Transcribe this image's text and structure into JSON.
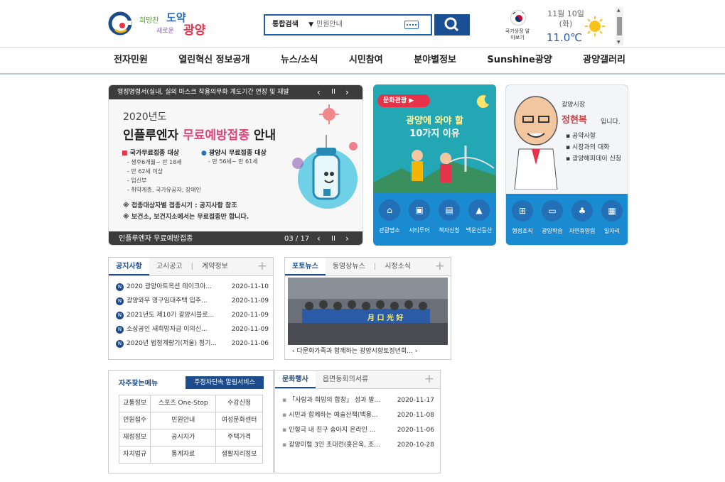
{
  "header": {
    "logo_slogan_1": "희망찬",
    "logo_slogan_2": "도약",
    "logo_slogan_3": "새로운",
    "logo_city": "광양",
    "search": {
      "scope": "통합검색",
      "placeholder": "민원안내"
    },
    "flag_label": "국가상징 알아보기",
    "weather": {
      "date": "11월 10일",
      "day": "(화)",
      "temp": "11.0℃",
      "icon": "sun-icon"
    }
  },
  "nav": [
    "전자민원",
    "열린혁신 정보공개",
    "뉴스/소식",
    "시민참여",
    "분야별정보",
    "Sunshine광양",
    "광양갤러리"
  ],
  "banner": {
    "ticker": "행정명령서(실내, 실외 마스크 착용의무화 계도기간 연장 및 재발",
    "year": "2020년도",
    "title_1": "인플루엔자",
    "title_2": "무료예방접종",
    "title_3": "안내",
    "col1_head": "국가무료접종 대상",
    "col1_items": [
      "- 생후6개월~ 만 18세",
      "- 만 62세 이상",
      "- 임신부",
      "- 취약계층, 국가유공자, 장애인"
    ],
    "col2_head": "광양시 무료접종 대상",
    "col2_items": [
      "- 만 56세~ 만 61세"
    ],
    "note1": "※ 접종대상자별 접종시기 : 공지사항 참조",
    "note2": "※ 보건소, 보건지소에서는 무료접종만 합니다.",
    "caption": "인플루엔자 무료예방접종",
    "page": "03 / 17"
  },
  "tour": {
    "badge": "문화관광",
    "title_1": "광양에 와야 할",
    "title_2": "10가지 이유",
    "icons": [
      {
        "label": "관광명소",
        "icon": "landmark-icon"
      },
      {
        "label": "시티투어",
        "icon": "bus-icon"
      },
      {
        "label": "책자신청",
        "icon": "book-icon"
      },
      {
        "label": "백운산등산",
        "icon": "mountain-icon"
      }
    ]
  },
  "mayor": {
    "label": "광양시장",
    "name": "정현복",
    "suffix": "입니다.",
    "links": [
      "공약사항",
      "시장과의 대화",
      "광양해피데이 신청"
    ],
    "icons": [
      {
        "label": "행정조직",
        "icon": "org-chart-icon"
      },
      {
        "label": "광양학습",
        "icon": "open-book-icon"
      },
      {
        "label": "자연휴양림",
        "icon": "sprout-icon"
      },
      {
        "label": "일자리",
        "icon": "briefcase-icon"
      }
    ]
  },
  "notice": {
    "tabs": [
      "공지사항",
      "고시공고",
      "계약정보"
    ],
    "rows": [
      {
        "title": "2020 광양아트옥션 테이크아...",
        "date": "2020-11-10"
      },
      {
        "title": "광양와우 영구임대주택 입주...",
        "date": "2020-11-09"
      },
      {
        "title": "2021년도 제10기 광양시블로...",
        "date": "2020-11-09"
      },
      {
        "title": "소상공인 새희망자금 이의신...",
        "date": "2020-11-09"
      },
      {
        "title": "2020년 법정계량기(저울) 정기...",
        "date": "2020-11-06"
      }
    ]
  },
  "photo": {
    "tabs": [
      "포토뉴스",
      "동영상뉴스",
      "시정소식"
    ],
    "banner_text": "月 口 光 好",
    "caption": "다문화가족과 함께하는 광양시향토정년회..."
  },
  "menu": {
    "title": "자주찾는메뉴",
    "service": "주정차단속 알림서비스",
    "cells": [
      [
        "교통정보",
        "스포츠 One-Stop",
        "수강신청"
      ],
      [
        "민원접수",
        "민원안내",
        "여성문화센터"
      ],
      [
        "재정정보",
        "공시지가",
        "주택가격"
      ],
      [
        "자치법규",
        "통계자료",
        "생활지리정보"
      ]
    ]
  },
  "culture": {
    "tabs": [
      "문화행사",
      "읍면동회의서류"
    ],
    "rows": [
      {
        "title": "「사랑과 희망의 합창」 성과 발...",
        "date": "2020-11-17"
      },
      {
        "title": "시민과 함께하는 예술산책(백용...",
        "date": "2020-11-08"
      },
      {
        "title": "인형극 내 친구 송아지 온라인 ...",
        "date": "2020-11-06"
      },
      {
        "title": "광양미협 3인 초대전(홍은옥, 조...",
        "date": "2020-10-28"
      }
    ]
  }
}
